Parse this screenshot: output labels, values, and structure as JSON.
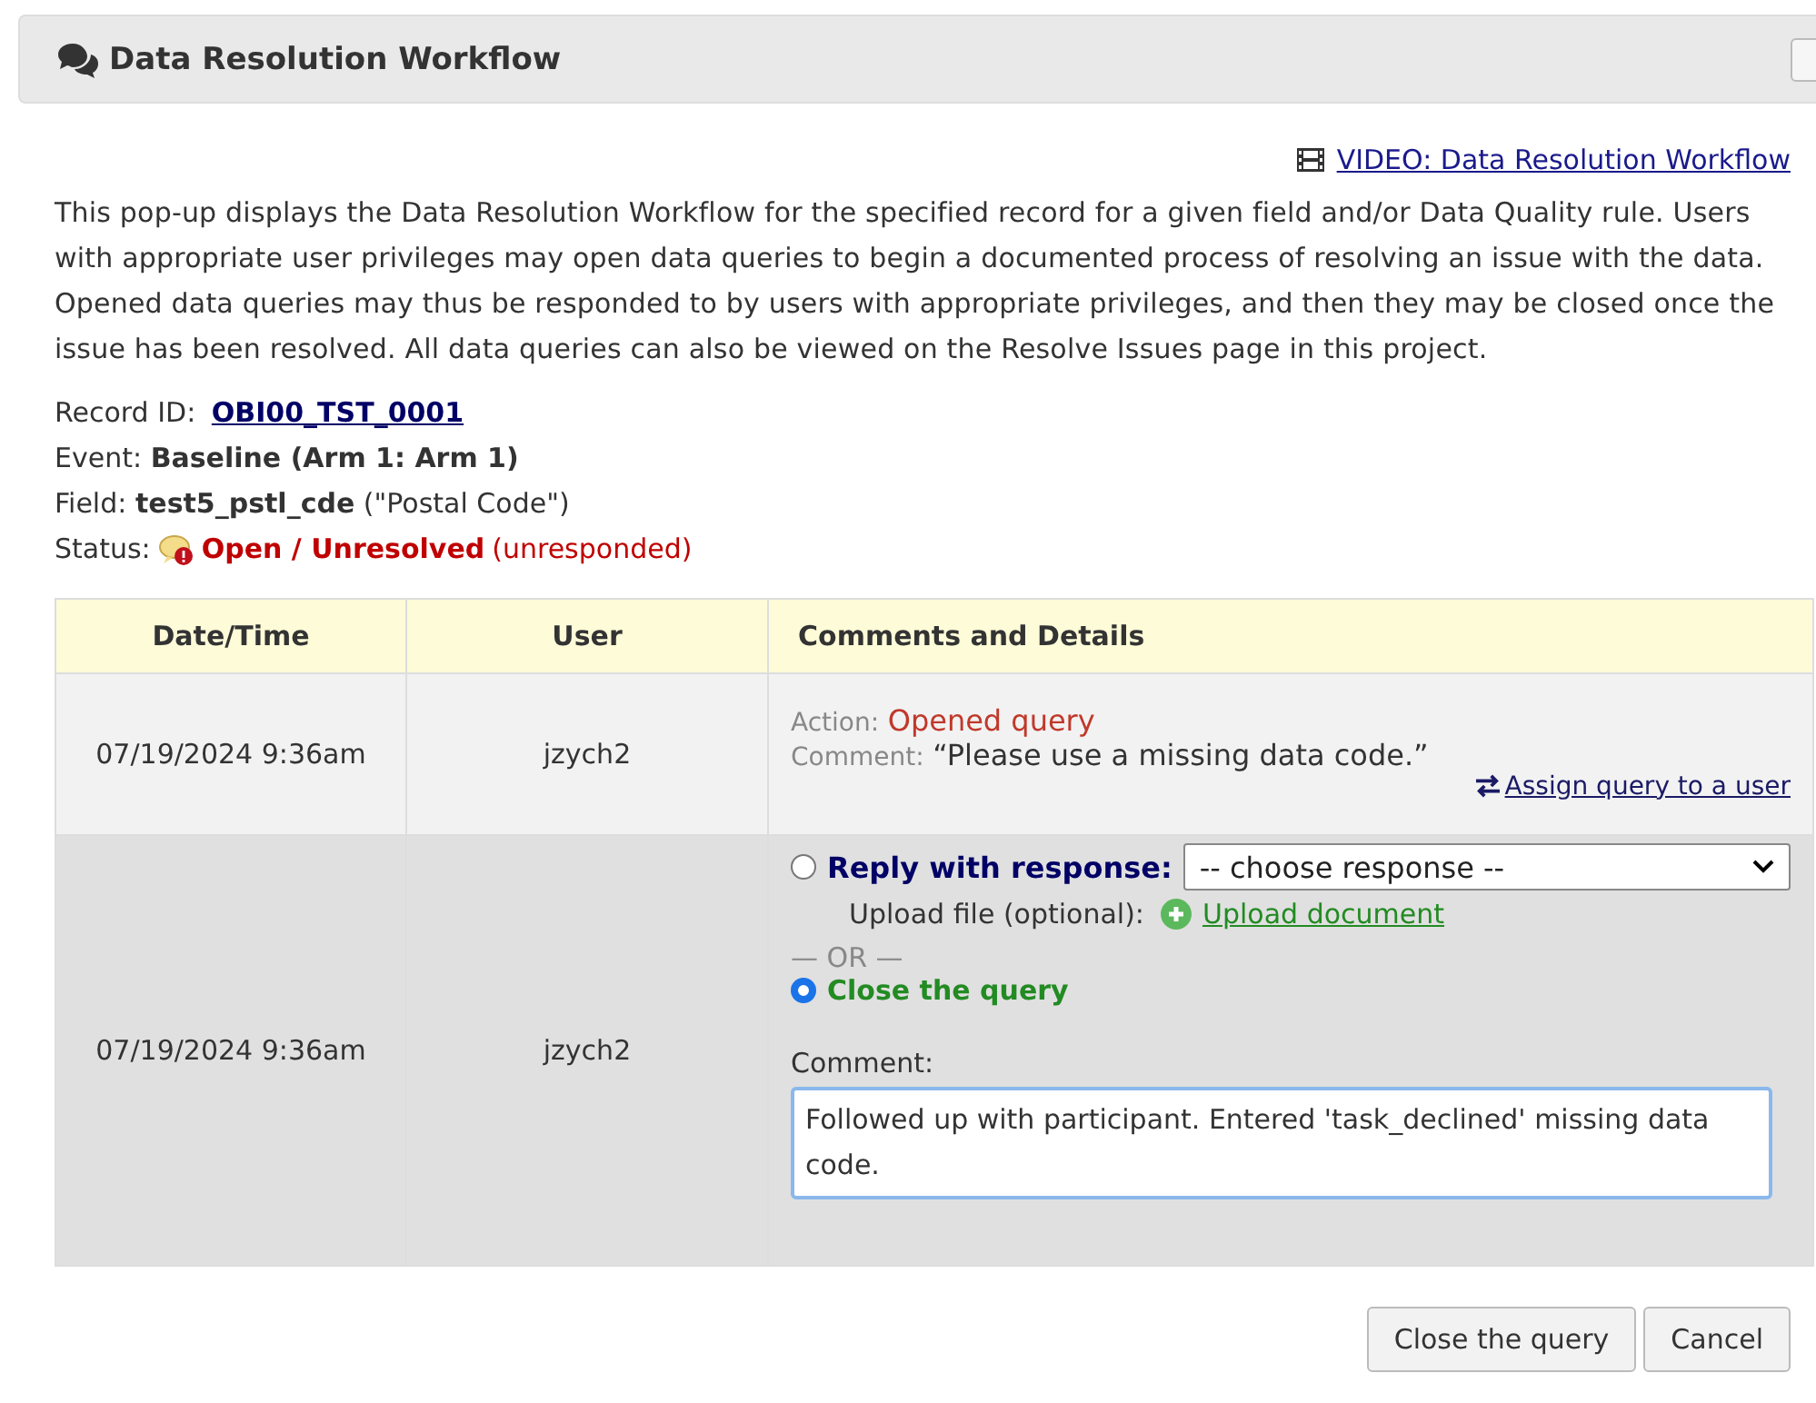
{
  "dialog": {
    "title": "Data Resolution Workflow"
  },
  "video_link": "VIDEO: Data Resolution Workflow",
  "intro": "This pop-up displays the Data Resolution Workflow for the specified record for a given field and/or Data Quality rule. Users with appropriate user privileges may open data queries to begin a documented process of resolving an issue with the data. Opened data queries may thus be responded to by users with appropriate privileges, and then they may be closed once the issue has been resolved. All data queries can also be viewed on the Resolve Issues page in this project.",
  "record": {
    "label": "Record ID:",
    "value": "OBI00_TST_0001"
  },
  "event": {
    "label": "Event:",
    "value": "Baseline (Arm 1: Arm 1)"
  },
  "field": {
    "label": "Field:",
    "value": "test5_pstl_cde",
    "note": "(\"Postal Code\")"
  },
  "status": {
    "label": "Status:",
    "value": "Open / Unresolved",
    "note": "(unresponded)"
  },
  "table": {
    "columns": [
      "Date/Time",
      "User",
      "Comments and Details"
    ],
    "history": {
      "date": "07/19/2024 9:36am",
      "user": "jzych2",
      "action_label": "Action:",
      "action": "Opened query",
      "comment_label": "Comment:",
      "comment": "“Please use a missing data code.”",
      "assign_link": "Assign query to a user"
    },
    "reply": {
      "date": "07/19/2024 9:36am",
      "user": "jzych2",
      "options": [
        {
          "kind": "reply",
          "label": "Reply with response:",
          "selected": false
        },
        {
          "kind": "close",
          "label": "Close the query",
          "selected": true
        }
      ],
      "response_select": "-- choose response --",
      "upload_label": "Upload file (optional):",
      "upload_link": "Upload document",
      "or": "— OR —",
      "comment_label": "Comment:",
      "comment": "Followed up with participant. Entered 'task_declined' missing data code."
    }
  },
  "buttons": [
    "Close the query",
    "Cancel"
  ]
}
